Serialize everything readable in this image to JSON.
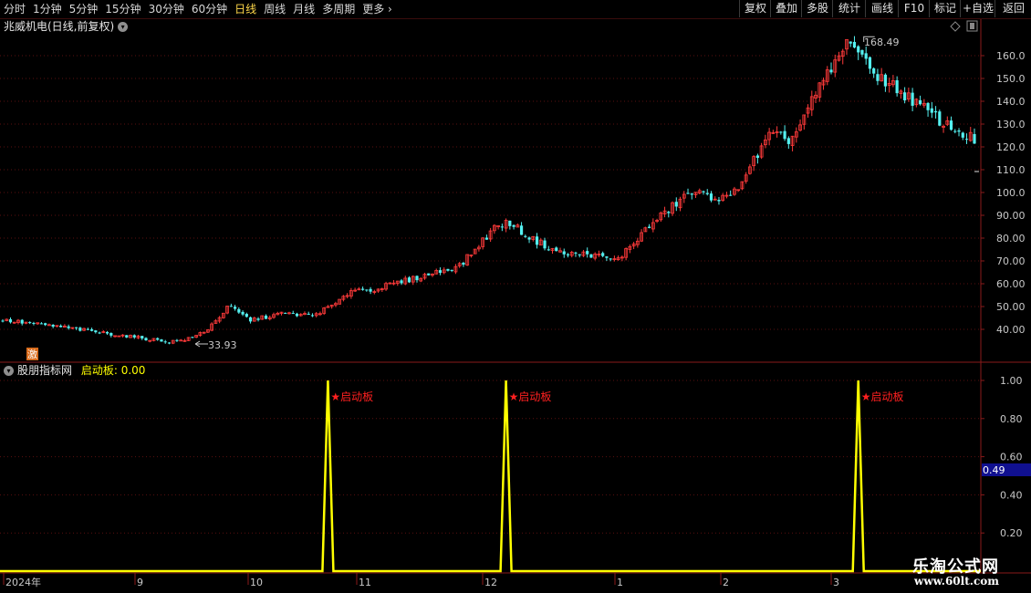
{
  "toolbar": {
    "timeframes": [
      "分时",
      "1分钟",
      "5分钟",
      "15分钟",
      "30分钟",
      "60分钟",
      "日线",
      "周线",
      "月线",
      "多周期",
      "更多"
    ],
    "active": "日线",
    "right_buttons": [
      "复权",
      "叠加",
      "多股",
      "统计",
      "画线",
      "F10",
      "标记",
      "+自选",
      "返回"
    ]
  },
  "main_chart": {
    "title": "兆威机电(日线,前复权)",
    "high_label": "168.49",
    "low_label": "33.93",
    "marker": "激",
    "price_ticks": [
      "160.0",
      "150.0",
      "140.0",
      "130.0",
      "120.0",
      "110.0",
      "100.0",
      "90.00",
      "80.00",
      "70.00",
      "60.00",
      "50.00",
      "40.00"
    ],
    "up_color": "#ff3a3a",
    "down_color": "#54f0f0"
  },
  "indicator": {
    "name": "股朋指标网",
    "label": "启动板",
    "value": "0.00",
    "signal_text": "★启动板",
    "ticks": [
      "1.00",
      "0.80",
      "0.60",
      "0.40",
      "0.20"
    ],
    "current_value": "0.49",
    "line_color": "#ffff00",
    "signals": [
      {
        "index": 84,
        "value": 1
      },
      {
        "index": 130,
        "value": 1
      },
      {
        "index": 221,
        "value": 1
      }
    ]
  },
  "date_axis": [
    "2024年",
    "9",
    "10",
    "11",
    "12",
    "1",
    "2",
    "3"
  ],
  "watermark": {
    "title": "乐淘公式网",
    "url": "www.60lt.com"
  },
  "chart_data": {
    "type": "candlestick",
    "title": "兆威机电(日线,前复权)",
    "ylim": [
      33,
      168.49
    ],
    "x": [
      "2024年",
      "9",
      "10",
      "11",
      "12",
      "1",
      "2",
      "3"
    ],
    "series": [
      {
        "name": "启动板",
        "values": [
          0,
          1,
          0,
          1,
          0,
          1,
          0
        ]
      }
    ],
    "points": [
      {
        "x": "2024-08",
        "y": 44
      },
      {
        "x": "2024-09 low",
        "y": 33.93
      },
      {
        "x": "2024-10",
        "y": 50
      },
      {
        "x": "2024-11",
        "y": 65
      },
      {
        "x": "2024-12",
        "y": 87
      },
      {
        "x": "2025-01",
        "y": 73
      },
      {
        "x": "2025-02",
        "y": 130
      },
      {
        "x": "2025-03 high",
        "y": 168.49
      },
      {
        "x": "2025-03 last",
        "y": 123
      }
    ]
  }
}
